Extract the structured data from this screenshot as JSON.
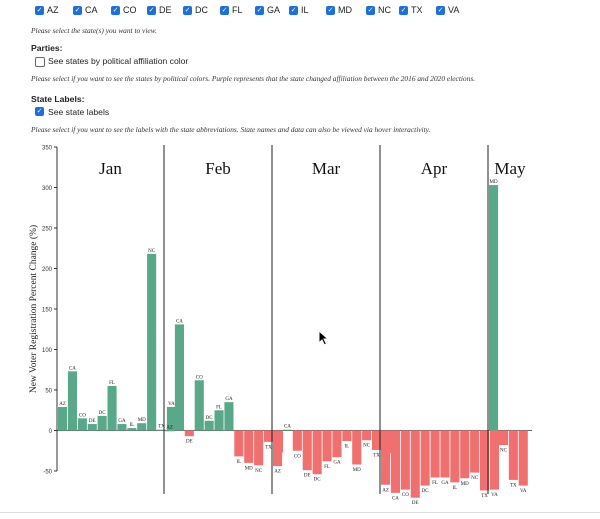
{
  "state_selector": {
    "states": [
      {
        "code": "AZ",
        "checked": true
      },
      {
        "code": "CA",
        "checked": true
      },
      {
        "code": "CO",
        "checked": true
      },
      {
        "code": "DE",
        "checked": true
      },
      {
        "code": "DC",
        "checked": true
      },
      {
        "code": "FL",
        "checked": true
      },
      {
        "code": "GA",
        "checked": true
      },
      {
        "code": "IL",
        "checked": true
      },
      {
        "code": "MD",
        "checked": true
      },
      {
        "code": "NC",
        "checked": true
      },
      {
        "code": "TX",
        "checked": true
      },
      {
        "code": "VA",
        "checked": true
      }
    ],
    "note": "Please select the state(s) you want to view."
  },
  "parties": {
    "heading": "Parties:",
    "option_label": "See states by political affiliation color",
    "checked": false,
    "note": "Please select if you want to see the states by political colors. Purple represents that the state changed affiliation between the 2016 and 2020 elections."
  },
  "state_labels": {
    "heading": "State Labels:",
    "option_label": "See state labels",
    "checked": true,
    "note": "Please select if you want to see the labels with the state abbreviations. State names and data can also be viewed via hover interactivity."
  },
  "chart_data": {
    "type": "bar",
    "title": "",
    "xlabel": "",
    "ylabel": "New Voter Registration Percent Change (%)",
    "ylim": [
      -50,
      350
    ],
    "yticks": [
      "350",
      "300",
      "250",
      "200",
      "150",
      "100",
      "50",
      "0",
      "-50"
    ],
    "grid": false,
    "positive_color": "#5aa88a",
    "negative_color": "#f07070",
    "groups": [
      {
        "month": "Jan",
        "bars": [
          {
            "state": "AZ",
            "value": 29
          },
          {
            "state": "CA",
            "value": 73
          },
          {
            "state": "CO",
            "value": 15
          },
          {
            "state": "DE",
            "value": 8
          },
          {
            "state": "DC",
            "value": 18
          },
          {
            "state": "FL",
            "value": 55
          },
          {
            "state": "GA",
            "value": 8
          },
          {
            "state": "IL",
            "value": 3
          },
          {
            "state": "MD",
            "value": 9
          },
          {
            "state": "NC",
            "value": 218
          },
          {
            "state": "TX",
            "value": 1
          },
          {
            "state": "VA",
            "value": 29
          }
        ]
      },
      {
        "month": "Feb",
        "bars": [
          {
            "state": "AZ",
            "value": 0
          },
          {
            "state": "CA",
            "value": 131
          },
          {
            "state": "DE",
            "value": -7
          },
          {
            "state": "CO",
            "value": 62
          },
          {
            "state": "DC",
            "value": 12
          },
          {
            "state": "FL",
            "value": 25
          },
          {
            "state": "GA",
            "value": 35
          },
          {
            "state": "IL",
            "value": -32
          },
          {
            "state": "MD",
            "value": -40
          },
          {
            "state": "NC",
            "value": -43
          },
          {
            "state": "TX",
            "value": -14
          },
          {
            "state": "VA",
            "value": -27
          }
        ]
      },
      {
        "month": "Mar",
        "bars": [
          {
            "state": "AZ",
            "value": -44
          },
          {
            "state": "CA",
            "value": 1
          },
          {
            "state": "CO",
            "value": -25
          },
          {
            "state": "DE",
            "value": -49
          },
          {
            "state": "DC",
            "value": -54
          },
          {
            "state": "FL",
            "value": -38
          },
          {
            "state": "GA",
            "value": -33
          },
          {
            "state": "IL",
            "value": -13
          },
          {
            "state": "MD",
            "value": -42
          },
          {
            "state": "NC",
            "value": -12
          },
          {
            "state": "TX",
            "value": -24
          },
          {
            "state": "VA",
            "value": -28
          }
        ]
      },
      {
        "month": "Apr",
        "bars": [
          {
            "state": "AZ",
            "value": -67
          },
          {
            "state": "CA",
            "value": -77
          },
          {
            "state": "CO",
            "value": -73
          },
          {
            "state": "DE",
            "value": -83
          },
          {
            "state": "DC",
            "value": -68
          },
          {
            "state": "FL",
            "value": -58
          },
          {
            "state": "GA",
            "value": -58
          },
          {
            "state": "IL",
            "value": -64
          },
          {
            "state": "MD",
            "value": -59
          },
          {
            "state": "NC",
            "value": -52
          },
          {
            "state": "TX",
            "value": -74
          },
          {
            "state": "VA",
            "value": -73
          }
        ]
      },
      {
        "month": "May",
        "bars": [
          {
            "state": "MD",
            "value": 303
          },
          {
            "state": "NC",
            "value": -18
          },
          {
            "state": "TX",
            "value": -61
          },
          {
            "state": "VA",
            "value": -68
          }
        ]
      }
    ]
  }
}
